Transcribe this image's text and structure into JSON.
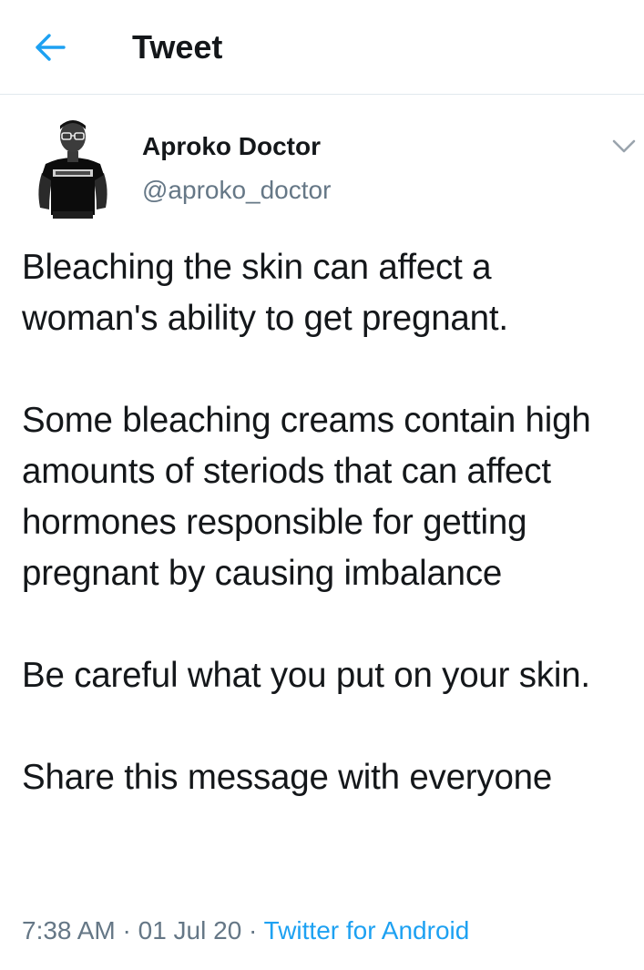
{
  "header": {
    "title": "Tweet",
    "back_icon": "arrow-left-icon",
    "accent_color": "#1da1f2"
  },
  "author": {
    "name": "Aproko Doctor",
    "handle": "@aproko_doctor",
    "avatar_icon": "profile-photo"
  },
  "tweet": {
    "paragraphs": [
      "Bleaching the skin can affect a woman's ability to get pregnant.",
      "Some bleaching creams contain high amounts of steriods that can affect hormones responsible for getting pregnant by causing imbalance",
      "Be careful what you put on your skin.",
      "Share this message with everyone"
    ]
  },
  "meta": {
    "time": "7:38 AM",
    "date": "01 Jul 20",
    "separator": " · ",
    "source": "Twitter for Android"
  },
  "colors": {
    "text": "#14171a",
    "secondary": "#657786",
    "link": "#1da1f2",
    "divider": "#e1e8ed"
  }
}
